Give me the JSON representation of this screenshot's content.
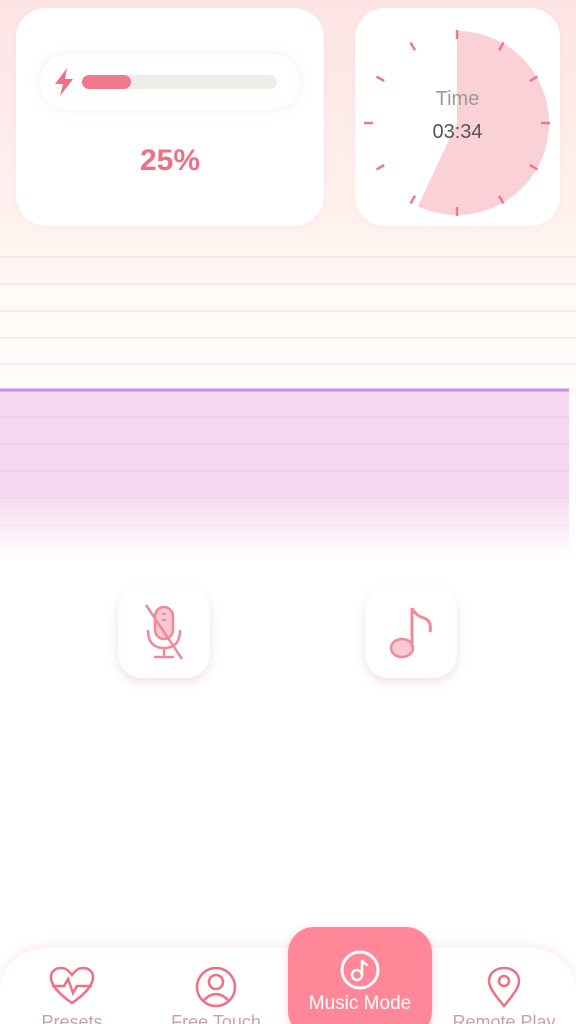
{
  "battery": {
    "icon": "bolt-icon",
    "level_fraction": 0.25,
    "percent_text": "25%"
  },
  "timer": {
    "label": "Time",
    "value": "03:34",
    "elapsed_fraction": 0.57
  },
  "controls": {
    "mic_icon": "mic-off-icon",
    "music_icon": "music-note-icon"
  },
  "tabs": [
    {
      "label": "Presets",
      "icon": "heart-pulse-icon"
    },
    {
      "label": "Free Touch",
      "icon": "user-circle-icon"
    },
    {
      "label": "Music Mode",
      "icon": "music-disc-icon",
      "active": true
    },
    {
      "label": "Remote Play",
      "icon": "location-pin-icon"
    }
  ],
  "colors": {
    "accent": "#ff8797",
    "battery_fill": "#f07a8c",
    "level_fill": "#f5d8ef",
    "level_line": "#c88ef0"
  }
}
